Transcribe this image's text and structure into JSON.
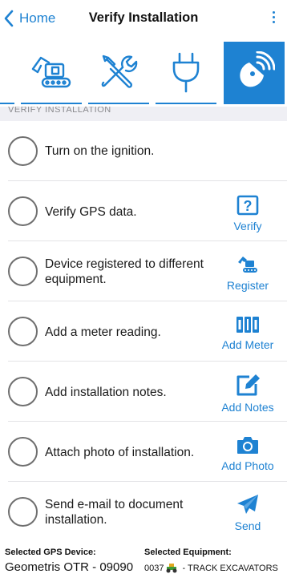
{
  "header": {
    "back_label": "Home",
    "title": "Verify Installation"
  },
  "tabs": [
    {
      "icon": "excavator-icon",
      "active": false
    },
    {
      "icon": "tools-icon",
      "active": false
    },
    {
      "icon": "power-plug-icon",
      "active": false
    },
    {
      "icon": "satellite-dish-icon",
      "active": true
    }
  ],
  "section_header": "VERIFY INSTALLATION",
  "steps": [
    {
      "text": "Turn on the ignition.",
      "action_label": "",
      "action_icon": ""
    },
    {
      "text": "Verify GPS data.",
      "action_label": "Verify",
      "action_icon": "question-box-icon"
    },
    {
      "text": "Device registered to different equipment.",
      "action_label": "Register",
      "action_icon": "excavator-icon"
    },
    {
      "text": "Add a meter reading.",
      "action_label": "Add Meter",
      "action_icon": "meter-counter-icon"
    },
    {
      "text": "Add installation notes.",
      "action_label": "Add Notes",
      "action_icon": "edit-note-icon"
    },
    {
      "text": "Attach photo of installation.",
      "action_label": "Add Photo",
      "action_icon": "camera-icon"
    },
    {
      "text": "Send e-mail to document installation.",
      "action_label": "Send",
      "action_icon": "send-icon"
    }
  ],
  "footer": {
    "device_label": "Selected GPS Device:",
    "device_value": "Geometris OTR - 09090",
    "equipment_label": "Selected Equipment:",
    "equipment_id": "0037",
    "equipment_name": "- TRACK EXCAVATORS"
  },
  "colors": {
    "accent": "#1e82d2",
    "circle_border": "#6f6f6f",
    "section_bg": "#efeff4"
  }
}
